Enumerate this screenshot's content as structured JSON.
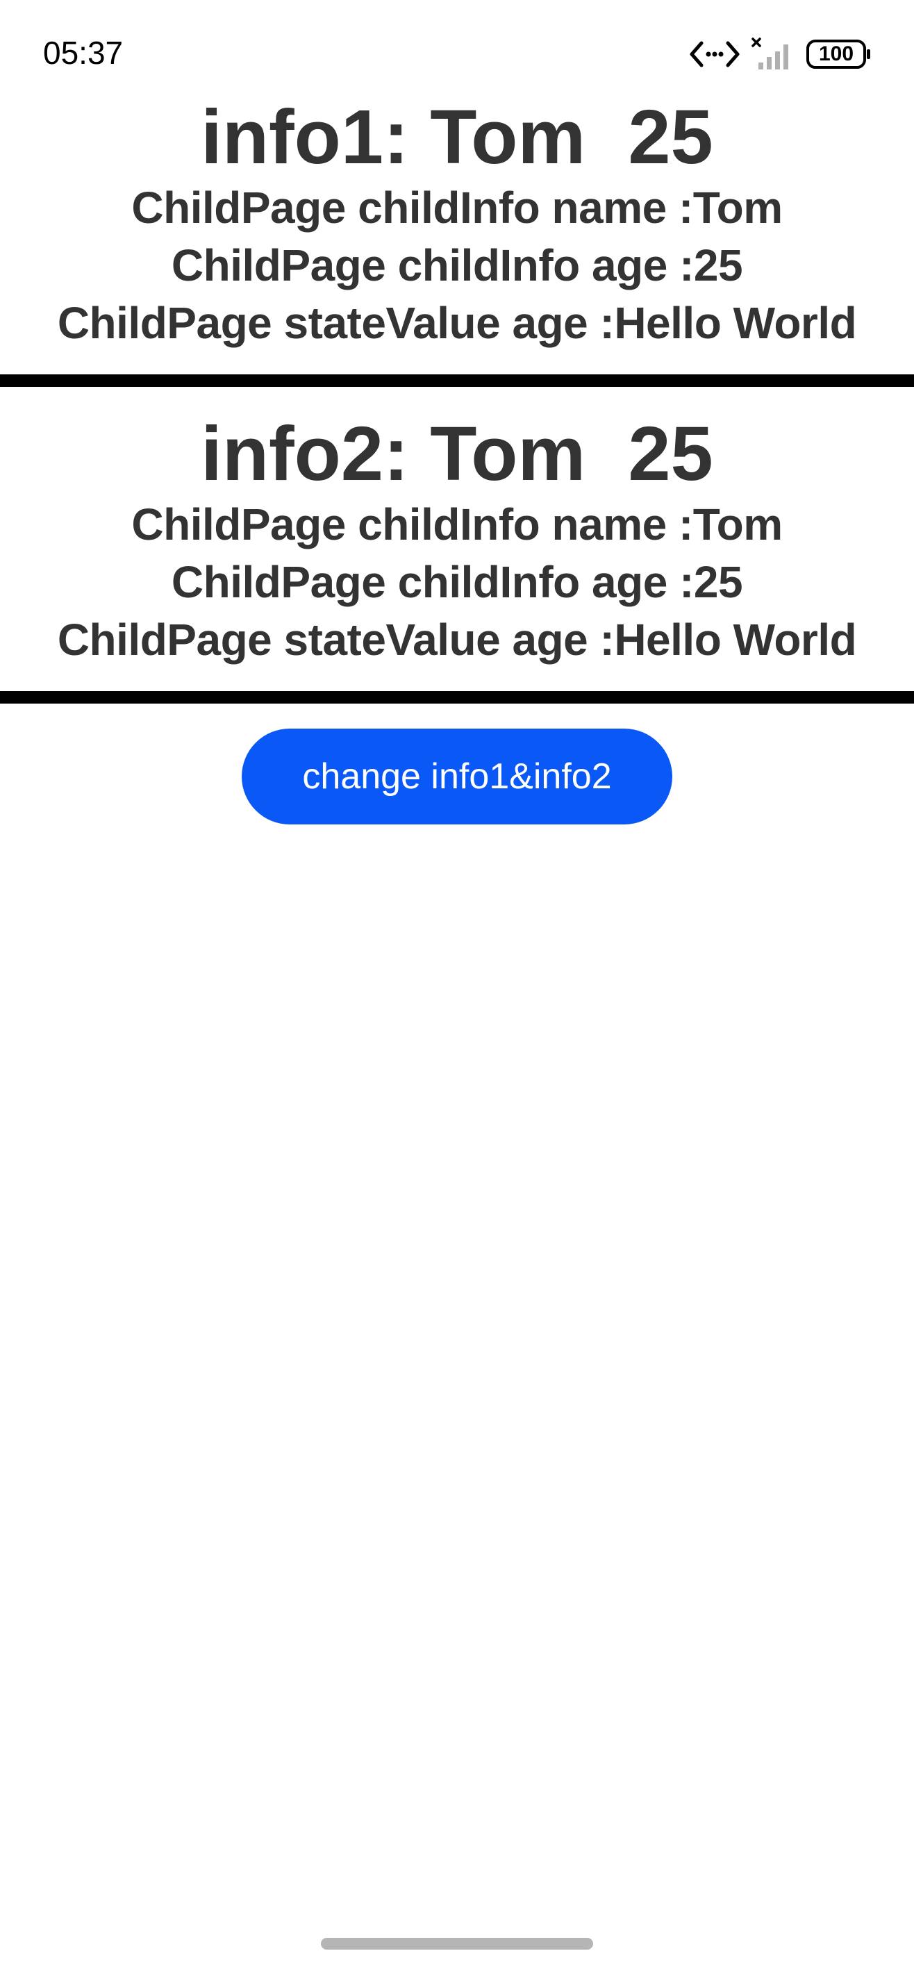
{
  "status_bar": {
    "time": "05:37",
    "battery_level": "100",
    "icons": [
      "data-transfer-icon",
      "no-signal-icon",
      "battery-icon"
    ]
  },
  "sections": [
    {
      "title": "info1: Tom  25",
      "lines": [
        "ChildPage childInfo name :Tom",
        "ChildPage childInfo age :25",
        "ChildPage stateValue age :Hello World"
      ]
    },
    {
      "title": "info2: Tom  25",
      "lines": [
        "ChildPage childInfo name :Tom",
        "ChildPage childInfo age :25",
        "ChildPage stateValue age :Hello World"
      ]
    }
  ],
  "button": {
    "label": "change info1&info2"
  },
  "colors": {
    "accent": "#0a59f7",
    "text": "#333333",
    "divider": "#000000"
  }
}
